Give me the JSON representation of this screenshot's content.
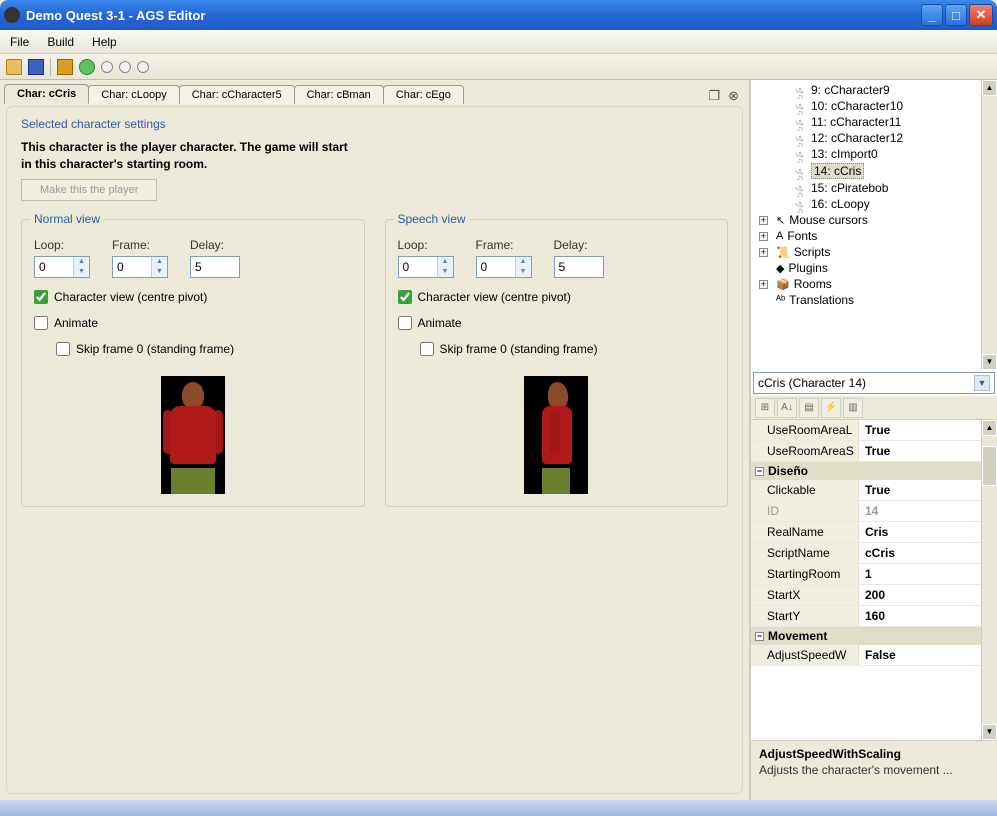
{
  "window": {
    "title": "Demo Quest 3-1 - AGS Editor"
  },
  "menu": {
    "file": "File",
    "build": "Build",
    "help": "Help"
  },
  "tabs": [
    {
      "label": "Char: cCris",
      "active": true
    },
    {
      "label": "Char: cLoopy"
    },
    {
      "label": "Char: cCharacter5"
    },
    {
      "label": "Char: cBman"
    },
    {
      "label": "Char: cEgo"
    }
  ],
  "panel": {
    "section_title": "Selected character settings",
    "player_note_l1": "This character is the player character. The game will start",
    "player_note_l2": "in this character's starting room.",
    "make_player_btn": "Make this the player",
    "normal": {
      "legend": "Normal view",
      "loop_label": "Loop:",
      "loop": "0",
      "frame_label": "Frame:",
      "frame": "0",
      "delay_label": "Delay:",
      "delay": "5",
      "cb_center": "Character view (centre pivot)",
      "cb_center_checked": true,
      "cb_animate": "Animate",
      "cb_animate_checked": false,
      "cb_skip": "Skip frame 0 (standing frame)",
      "cb_skip_checked": false
    },
    "speech": {
      "legend": "Speech view",
      "loop_label": "Loop:",
      "loop": "0",
      "frame_label": "Frame:",
      "frame": "0",
      "delay_label": "Delay:",
      "delay": "5",
      "cb_center": "Character view (centre pivot)",
      "cb_center_checked": true,
      "cb_animate": "Animate",
      "cb_animate_checked": false,
      "cb_skip": "Skip frame 0 (standing frame)",
      "cb_skip_checked": false
    }
  },
  "tree": {
    "characters": [
      "9: cCharacter9",
      "10: cCharacter10",
      "11: cCharacter11",
      "12: cCharacter12",
      "13: cImport0",
      "14: cCris",
      "15: cPiratebob",
      "16: cLoopy"
    ],
    "selected": "14: cCris",
    "nodes": [
      {
        "label": "Mouse cursors",
        "expandable": true
      },
      {
        "label": "Fonts",
        "expandable": true
      },
      {
        "label": "Scripts",
        "expandable": true
      },
      {
        "label": "Plugins",
        "expandable": false
      },
      {
        "label": "Rooms",
        "expandable": true
      },
      {
        "label": "Translations",
        "expandable": false
      }
    ]
  },
  "propSelector": "cCris (Character 14)",
  "properties": {
    "rows_top": [
      {
        "name": "UseRoomAreaL",
        "value": "True"
      },
      {
        "name": "UseRoomAreaS",
        "value": "True"
      }
    ],
    "cat1": "Diseño",
    "rows_design": [
      {
        "name": "Clickable",
        "value": "True"
      },
      {
        "name": "ID",
        "value": "14",
        "readonly": true
      },
      {
        "name": "RealName",
        "value": "Cris"
      },
      {
        "name": "ScriptName",
        "value": "cCris"
      },
      {
        "name": "StartingRoom",
        "value": "1"
      },
      {
        "name": "StartX",
        "value": "200"
      },
      {
        "name": "StartY",
        "value": "160"
      }
    ],
    "cat2": "Movement",
    "rows_move": [
      {
        "name": "AdjustSpeedW",
        "value": "False"
      }
    ]
  },
  "help": {
    "title": "AdjustSpeedWithScaling",
    "desc": "Adjusts the character's movement ..."
  }
}
